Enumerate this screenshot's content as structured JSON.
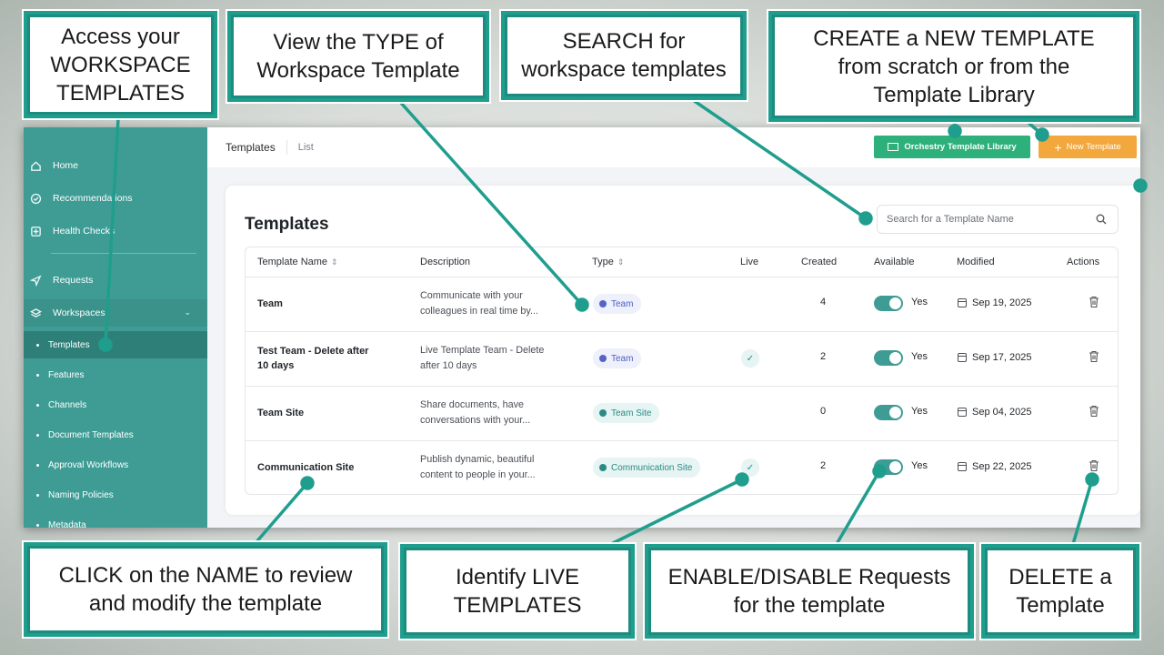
{
  "sidebar": {
    "items": [
      {
        "label": "Home",
        "icon": "home-icon"
      },
      {
        "label": "Recommendations",
        "icon": "check-circle-icon"
      },
      {
        "label": "Health Checks",
        "icon": "health-icon"
      },
      {
        "label": "Requests",
        "icon": "send-icon"
      },
      {
        "label": "Workspaces",
        "icon": "layers-icon"
      }
    ],
    "sub_items": [
      "Templates",
      "Features",
      "Channels",
      "Document Templates",
      "Approval Workflows",
      "Naming Policies",
      "Metadata"
    ]
  },
  "topbar": {
    "tab_templates": "Templates",
    "tab_list": "List",
    "library_button": "Orchestry Template Library",
    "new_button": "New Template"
  },
  "main": {
    "title": "Templates",
    "search_placeholder": "Search for a Template Name",
    "columns": [
      "Template Name",
      "Description",
      "Type",
      "Live",
      "Created",
      "Available",
      "Modified",
      "Actions"
    ],
    "rows": [
      {
        "name": "Team",
        "desc1": "Communicate with your",
        "desc2": "colleagues in real time by...",
        "type": "Team",
        "live": false,
        "created": "4",
        "available": "Yes",
        "modified": "Sep 19, 2025"
      },
      {
        "name": "Test Team - Delete after",
        "name2": "10 days",
        "desc1": "Live Template Team - Delete",
        "desc2": "after 10 days",
        "type": "Team",
        "live": true,
        "created": "2",
        "available": "Yes",
        "modified": "Sep 17, 2025"
      },
      {
        "name": "Team Site",
        "desc1": "Share documents, have",
        "desc2": "conversations with your...",
        "type": "Team Site",
        "live": false,
        "created": "0",
        "available": "Yes",
        "modified": "Sep 04, 2025"
      },
      {
        "name": "Communication Site",
        "desc1": "Publish dynamic, beautiful",
        "desc2": "content to people in your...",
        "type": "Communication Site",
        "live": true,
        "created": "2",
        "available": "Yes",
        "modified": "Sep 22, 2025"
      }
    ]
  },
  "callouts": {
    "access": [
      "Access your",
      "WORKSPACE",
      "TEMPLATES"
    ],
    "type": [
      "View the TYPE of",
      "Workspace Template"
    ],
    "search": [
      "SEARCH for",
      "workspace templates"
    ],
    "create": [
      "CREATE a NEW TEMPLATE",
      "from scratch or from the",
      "Template Library"
    ],
    "click": [
      "CLICK on the NAME to review",
      "and modify the template"
    ],
    "live": [
      "Identify LIVE",
      "TEMPLATES"
    ],
    "enable": [
      "ENABLE/DISABLE Requests",
      "for the template"
    ],
    "delete": [
      "DELETE a",
      "Template"
    ]
  },
  "colors": {
    "accent": "#3e9c95",
    "callout_border": "#1f9e8e",
    "library_button": "#2db07a",
    "new_button": "#f2a83c"
  }
}
